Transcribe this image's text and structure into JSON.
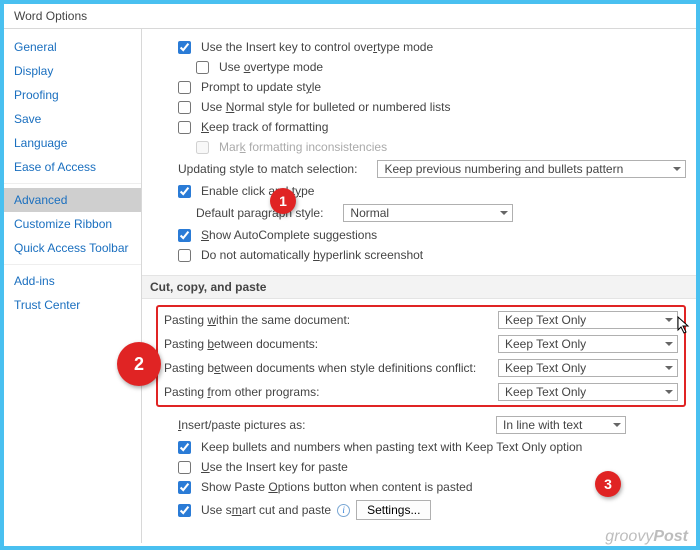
{
  "window": {
    "title": "Word Options"
  },
  "sidebar": {
    "items": [
      {
        "label": "General"
      },
      {
        "label": "Display"
      },
      {
        "label": "Proofing"
      },
      {
        "label": "Save"
      },
      {
        "label": "Language"
      },
      {
        "label": "Ease of Access"
      },
      {
        "label": "Advanced",
        "selected": true
      },
      {
        "label": "Customize Ribbon"
      },
      {
        "label": "Quick Access Toolbar"
      },
      {
        "label": "Add-ins"
      },
      {
        "label": "Trust Center"
      }
    ]
  },
  "opts": {
    "insertKeyOvertype": {
      "checked": true,
      "pre": "Use the Insert key to control ove",
      "uch": "r",
      "post": "type mode"
    },
    "overtype": {
      "checked": false,
      "pre": "Use ",
      "uch": "o",
      "post": "vertype mode"
    },
    "promptUpdate": {
      "checked": false,
      "pre": "Prompt to update st",
      "uch": "y",
      "post": "le"
    },
    "normalStyle": {
      "checked": false,
      "pre": "Use ",
      "uch": "N",
      "post": "ormal style for bulleted or numbered lists"
    },
    "keepTrack": {
      "checked": false,
      "pre": "",
      "uch": "K",
      "post": "eep track of formatting"
    },
    "markIncons": {
      "checked": false,
      "pre": "Mar",
      "uch": "k",
      "post": " formatting inconsistencies"
    },
    "updStyleSelLabel": "Updating style to match selection:",
    "updStyleSelValue": "Keep previous numbering and bullets pattern",
    "enableClickType": {
      "checked": true,
      "pre": "Enable click and t",
      "uch": "y",
      "post": "pe"
    },
    "defaultParaLabel": "Default paragraph style:",
    "defaultParaValue": "Normal",
    "showAutocomplete": {
      "checked": true,
      "pre": "",
      "uch": "S",
      "post": "how AutoComplete suggestions"
    },
    "hyperlinkScreenshot": {
      "checked": false,
      "pre": "Do not automatically ",
      "uch": "h",
      "post": "yperlink screenshot"
    }
  },
  "sectionCCP": "Cut, copy, and paste",
  "paste": {
    "rows": [
      {
        "pre": "Pasting ",
        "uch": "w",
        "post": "ithin the same document:",
        "value": "Keep Text Only"
      },
      {
        "pre": "Pasting ",
        "uch": "b",
        "post": "etween documents:",
        "value": "Keep Text Only"
      },
      {
        "pre": "Pasting b",
        "uch": "e",
        "post": "tween documents when style definitions conflict:",
        "value": "Keep Text Only"
      },
      {
        "pre": "Pasting ",
        "uch": "f",
        "post": "rom other programs:",
        "value": "Keep Text Only"
      }
    ]
  },
  "insertPicLabel": {
    "pre": "",
    "uch": "I",
    "post": "nsert/paste pictures as:"
  },
  "insertPicValue": "In line with text",
  "opts2": {
    "keepBullets": {
      "checked": true,
      "text": "Keep bullets and numbers when pasting text with Keep Text Only option"
    },
    "insertKeyPaste": {
      "checked": false,
      "pre": "",
      "uch": "U",
      "post": "se the Insert key for paste"
    },
    "showPaste": {
      "checked": true,
      "pre": "Show Paste ",
      "uch": "O",
      "post": "ptions button when content is pasted"
    },
    "smartCut": {
      "checked": true,
      "pre": "Use s",
      "uch": "m",
      "post": "art cut and paste"
    }
  },
  "settingsBtn": "Settings...",
  "watermark": {
    "a": "groovy",
    "b": "Post"
  }
}
